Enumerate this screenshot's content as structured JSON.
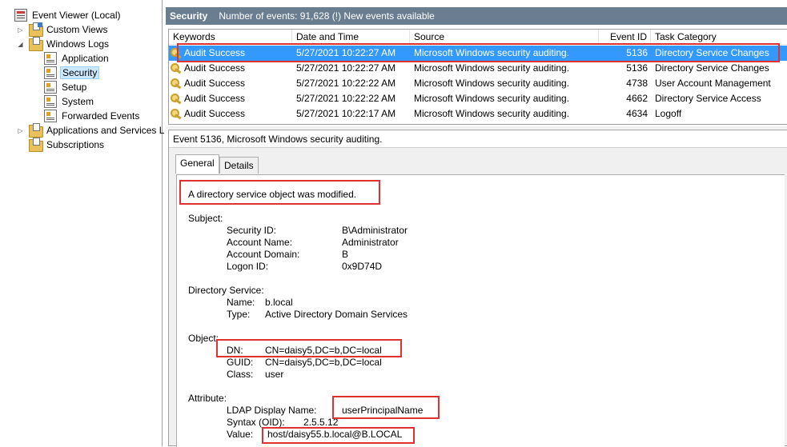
{
  "tree": {
    "root": "Event Viewer (Local)",
    "custom_views": "Custom Views",
    "windows_logs": "Windows Logs",
    "logs": [
      "Application",
      "Security",
      "Setup",
      "System",
      "Forwarded Events"
    ],
    "apps_services": "Applications and Services L",
    "subscriptions": "Subscriptions"
  },
  "header": {
    "title": "Security",
    "summary": "Number of events: 91,628 (!) New events available"
  },
  "grid": {
    "columns": [
      "Keywords",
      "Date and Time",
      "Source",
      "Event ID",
      "Task Category"
    ],
    "rows": [
      {
        "keywords": "Audit Success",
        "date": "5/27/2021 10:22:27 AM",
        "source": "Microsoft Windows security auditing.",
        "event_id": "5136",
        "category": "Directory Service Changes",
        "selected": true
      },
      {
        "keywords": "Audit Success",
        "date": "5/27/2021 10:22:27 AM",
        "source": "Microsoft Windows security auditing.",
        "event_id": "5136",
        "category": "Directory Service Changes"
      },
      {
        "keywords": "Audit Success",
        "date": "5/27/2021 10:22:22 AM",
        "source": "Microsoft Windows security auditing.",
        "event_id": "4738",
        "category": "User Account Management"
      },
      {
        "keywords": "Audit Success",
        "date": "5/27/2021 10:22:22 AM",
        "source": "Microsoft Windows security auditing.",
        "event_id": "4662",
        "category": "Directory Service Access"
      },
      {
        "keywords": "Audit Success",
        "date": "5/27/2021 10:22:17 AM",
        "source": "Microsoft Windows security auditing.",
        "event_id": "4634",
        "category": "Logoff"
      }
    ]
  },
  "detail": {
    "title": "Event 5136, Microsoft Windows security auditing.",
    "tabs": [
      "General",
      "Details"
    ],
    "message": "A directory service object was modified.",
    "subject_header": "Subject:",
    "subject": [
      {
        "label": "Security ID:",
        "value": "B\\Administrator"
      },
      {
        "label": "Account Name:",
        "value": "Administrator"
      },
      {
        "label": "Account Domain:",
        "value": "B"
      },
      {
        "label": "Logon ID:",
        "value": "0x9D74D"
      }
    ],
    "ds_header": "Directory Service:",
    "ds": [
      {
        "label": "Name:",
        "value": "b.local"
      },
      {
        "label": "Type:",
        "value": "Active Directory Domain Services"
      }
    ],
    "object_header": "Object:",
    "object": [
      {
        "label": "DN:",
        "value": "CN=daisy5,DC=b,DC=local"
      },
      {
        "label": "GUID:",
        "value": "CN=daisy5,DC=b,DC=local"
      },
      {
        "label": "Class:",
        "value": "user"
      }
    ],
    "attr_header": "Attribute:",
    "attribute": [
      {
        "label": "LDAP Display Name:",
        "value": "userPrincipalName"
      },
      {
        "label": "Syntax (OID):",
        "value": "2.5.5.12"
      },
      {
        "label": "Value:",
        "value": "host/daisy55.b.local@B.LOCAL"
      }
    ]
  },
  "colors": {
    "selection": "#3399ff",
    "header_bar": "#6b7e91",
    "highlight_box": "#e03030"
  }
}
